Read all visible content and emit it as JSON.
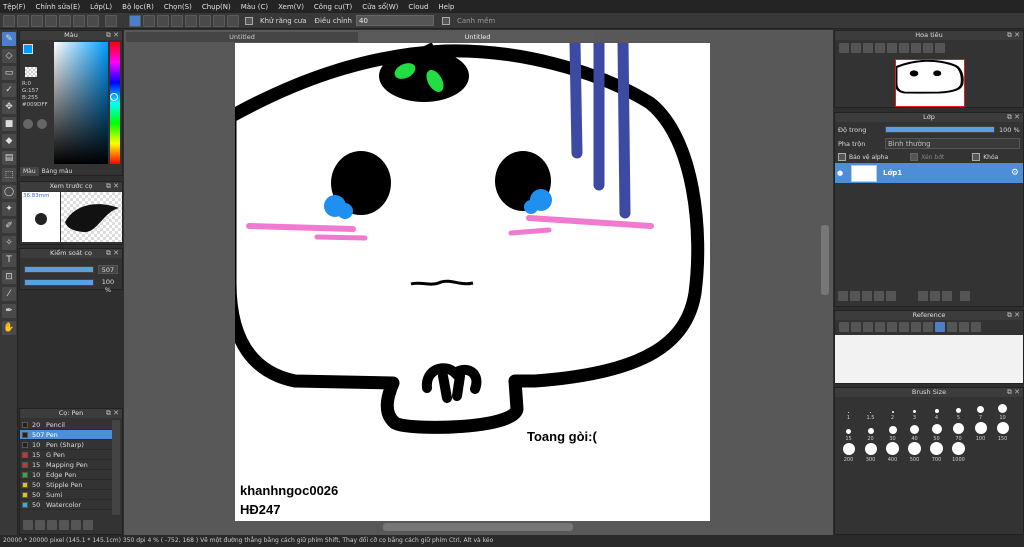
{
  "menu": [
    "Tệp(F)",
    "Chỉnh sửa(E)",
    "Lớp(L)",
    "Bộ lọc(R)",
    "Chọn(S)",
    "Chụp(N)",
    "Màu (C)",
    "Xem(V)",
    "Công cụ(T)",
    "Cửa sổ(W)",
    "Cloud",
    "Help"
  ],
  "toolbar": {
    "antialias_label": "Khử răng cưa",
    "adjust_label": "Điều chỉnh",
    "adjust_value": "40",
    "margin_label": "Canh mềm"
  },
  "tabs": {
    "left": "Untitled",
    "right": "Untitled"
  },
  "color_panel": {
    "title": "Màu",
    "r": "R:0",
    "g": "G:157",
    "b": "B:255",
    "hex": "#009DFF",
    "tab1": "Màu",
    "tab2": "Bảng màu"
  },
  "brush_preview": {
    "title": "Xem trước cọ",
    "size": "36.83mm"
  },
  "brush_control": {
    "title": "Kiểm soát cọ",
    "size": "507",
    "opacity": "100 %"
  },
  "pen_panel": {
    "title": "Cọ: Pen",
    "items": [
      {
        "num": "20",
        "name": "Pencil",
        "color": "#222222"
      },
      {
        "num": "507",
        "name": "Pen",
        "color": "#222222"
      },
      {
        "num": "10",
        "name": "Pen (Sharp)",
        "color": "#222222"
      },
      {
        "num": "15",
        "name": "G Pen",
        "color": "#d33030"
      },
      {
        "num": "15",
        "name": "Mapping Pen",
        "color": "#d33030"
      },
      {
        "num": "10",
        "name": "Edge Pen",
        "color": "#30b030"
      },
      {
        "num": "50",
        "name": "Stipple Pen",
        "color": "#e0c020"
      },
      {
        "num": "50",
        "name": "Sumi",
        "color": "#e0c020"
      },
      {
        "num": "50",
        "name": "Watercolor",
        "color": "#30b0e0"
      }
    ]
  },
  "navigator": {
    "title": "Hoa tiêu"
  },
  "layer_panel": {
    "title": "Lớp",
    "opacity_label": "Độ trong",
    "opacity_value": "100 %",
    "blend_label": "Pha trộn",
    "blend_value": "Bình thường",
    "protect_alpha": "Bảo vệ alpha",
    "clipping": "Xén bớt",
    "lock": "Khóa",
    "layer_name": "Lớp1"
  },
  "reference": {
    "title": "Reference"
  },
  "brush_size": {
    "title": "Brush Size",
    "sizes": [
      "1",
      "1.5",
      "2",
      "3",
      "4",
      "5",
      "7",
      "10",
      "15",
      "20",
      "30",
      "40",
      "50",
      "70",
      "100",
      "150",
      "200",
      "300",
      "400",
      "500",
      "700",
      "1000"
    ]
  },
  "canvas_text": {
    "caption": "Toang gòi:(",
    "author": "khanhngoc0026",
    "code": "HĐ247"
  },
  "status": "20000 * 20000 pixel  (145.1 * 145.1cm)  350 dpi  4 %  ( -752, 168 )  Vẽ một đường thẳng bằng cách giữ phím Shift, Thay đổi cỡ cọ bằng cách giữ phím Ctrl, Alt và kéo",
  "colors": {
    "accent": "#4d8ed8",
    "current_color": "#009DFF"
  }
}
